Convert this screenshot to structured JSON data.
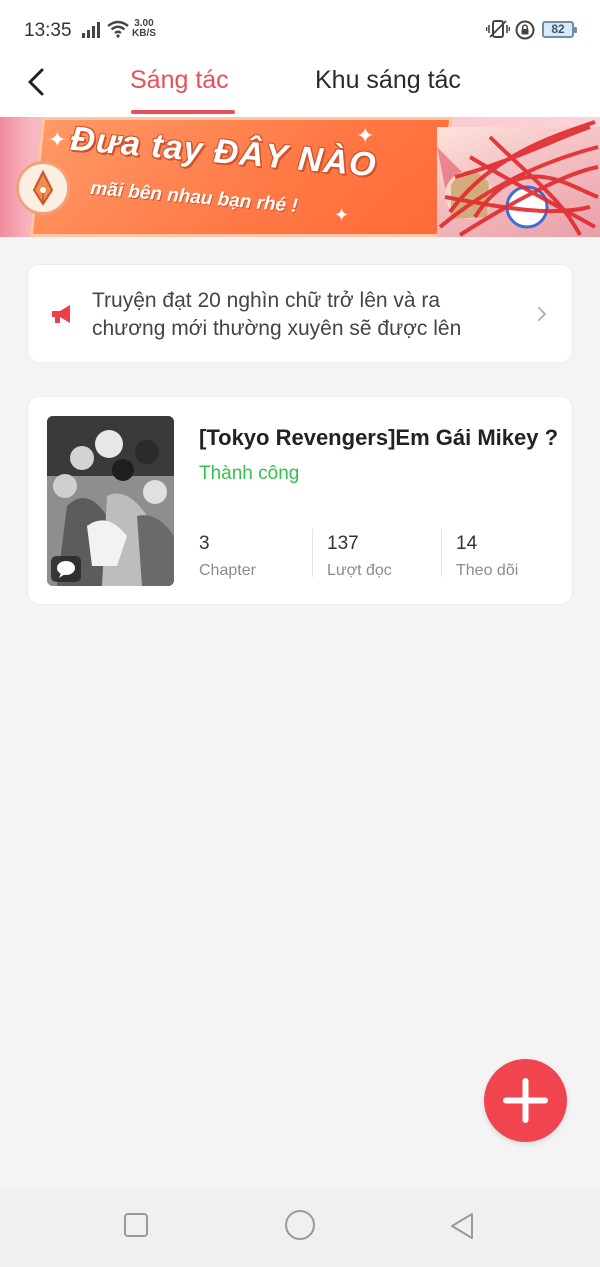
{
  "status_bar": {
    "time": "13:35",
    "net_speed_value": "3.00",
    "net_speed_unit": "KB/S",
    "battery_level": "82"
  },
  "header": {
    "tabs": [
      {
        "label": "Sáng tác",
        "active": true
      },
      {
        "label": "Khu sáng tác",
        "active": false
      }
    ]
  },
  "banner": {
    "title": "Đưa tay ĐÂY NÀO",
    "subtitle": "mãi bên nhau bạn rhé !"
  },
  "notice": {
    "text": "Truyện đạt 20 nghìn chữ trở lên và ra chương mới thường xuyên sẽ được lên"
  },
  "story": {
    "title": "[Tokyo Revengers]Em Gái Mikey ?",
    "status": "Thành công",
    "stats": [
      {
        "value": "3",
        "label": "Chapter"
      },
      {
        "value": "137",
        "label": "Lượt đọc"
      },
      {
        "value": "14",
        "label": "Theo dõi"
      }
    ]
  },
  "colors": {
    "accent": "#e94e5b",
    "success": "#33c24b",
    "fab": "#f0454f"
  }
}
